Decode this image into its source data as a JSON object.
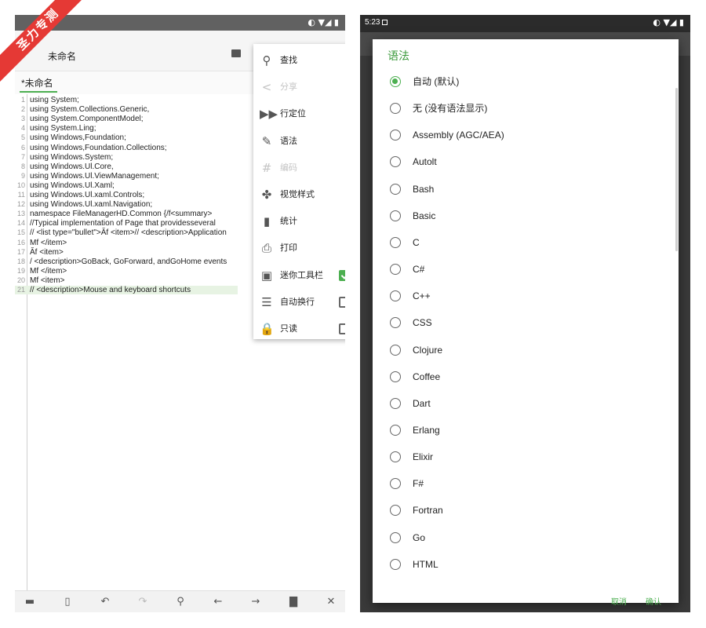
{
  "watermark": "圣力专测",
  "left": {
    "status_icons": "◐ ▼◢ ▮",
    "app_title": "未命名",
    "tab_label": "*未命名",
    "code_lines": [
      {
        "n": "1",
        "t": "using System;"
      },
      {
        "n": "2",
        "t": "using System.Collections.Generic,"
      },
      {
        "n": "3",
        "t": "using System.ComponentModel;"
      },
      {
        "n": "4",
        "t": "using System.Ling;"
      },
      {
        "n": "5",
        "t": "using Windows,Foundation;"
      },
      {
        "n": "6",
        "t": "using Windows,Foundation.Collections;"
      },
      {
        "n": "7",
        "t": "using Windows.System;"
      },
      {
        "n": "8",
        "t": "using Windows.Ul.Core,"
      },
      {
        "n": "9",
        "t": "using Windows.Ul.ViewManagement;"
      },
      {
        "n": "10",
        "t": "using Windows.Ul.Xaml;"
      },
      {
        "n": "11",
        "t": "using Windows.Ul.xaml.Controls;"
      },
      {
        "n": "12",
        "t": "using Windows.Ul.xaml.Navigation;"
      },
      {
        "n": "13",
        "t": "namespace FileManagerHD.Common {/f<summary>"
      },
      {
        "n": "14",
        "t": "//Typical implementation of Page that providesseveral"
      },
      {
        "n": "15",
        "t": "// <list type=\"bullet\">Ăf <item>// <description>Application"
      },
      {
        "n": "16",
        "t": "Mf </item>"
      },
      {
        "n": "17",
        "t": "Ăf <item>"
      },
      {
        "n": "18",
        "t": "/ <description>GoBack, GoForward, andGoHome events"
      },
      {
        "n": "19",
        "t": "Mf </item>"
      },
      {
        "n": "20",
        "t": "Mf <item>"
      },
      {
        "n": "21",
        "t": "// <description>Mouse and keyboard shortcuts"
      }
    ],
    "menu": [
      {
        "icon": "search-icon",
        "glyph": "⚲",
        "label": "查找",
        "disabled": false
      },
      {
        "icon": "share-icon",
        "glyph": "<",
        "label": "分享",
        "disabled": true
      },
      {
        "icon": "goto-line-icon",
        "glyph": "▶▶",
        "label": "行定位",
        "disabled": false
      },
      {
        "icon": "syntax-icon",
        "glyph": "✎",
        "label": "语法",
        "disabled": false
      },
      {
        "icon": "encoding-icon",
        "glyph": "#",
        "label": "编码",
        "disabled": true
      },
      {
        "icon": "visual-style-icon",
        "glyph": "✤",
        "label": "视觉样式",
        "disabled": false
      },
      {
        "icon": "statistics-icon",
        "glyph": "▮",
        "label": "统计",
        "disabled": false
      },
      {
        "icon": "print-icon",
        "glyph": "⎙",
        "label": "打印",
        "disabled": false
      },
      {
        "icon": "mini-toolbar-icon",
        "glyph": "▣",
        "label": "迷你工具栏",
        "disabled": false,
        "checked": true
      },
      {
        "icon": "word-wrap-icon",
        "glyph": "☰",
        "label": "自动换行",
        "disabled": false,
        "checked": false
      },
      {
        "icon": "lock-icon",
        "glyph": "🔒",
        "label": "只读",
        "disabled": false,
        "checked": false
      }
    ],
    "bottom_bar": [
      {
        "name": "open-folder-icon",
        "glyph": "▬",
        "dim": false
      },
      {
        "name": "new-file-icon",
        "glyph": "▯",
        "dim": false
      },
      {
        "name": "undo-icon",
        "glyph": "↶",
        "dim": false
      },
      {
        "name": "redo-icon",
        "glyph": "↷",
        "dim": true
      },
      {
        "name": "search-icon",
        "glyph": "⚲",
        "dim": false
      },
      {
        "name": "arrow-left-icon",
        "glyph": "←",
        "dim": false
      },
      {
        "name": "arrow-right-icon",
        "glyph": "→",
        "dim": false
      },
      {
        "name": "save-icon",
        "glyph": "▇",
        "dim": false
      },
      {
        "name": "close-icon",
        "glyph": "✕",
        "dim": false
      }
    ]
  },
  "right": {
    "status_time": "5:23",
    "status_icons": "◐ ▼◢ ▮",
    "dialog_title": "语法",
    "options": [
      {
        "label": "自动 (默认)",
        "selected": true
      },
      {
        "label": "无 (没有语法显示)",
        "selected": false
      },
      {
        "label": "Assembly (AGC/AEA)",
        "selected": false
      },
      {
        "label": "Autolt",
        "selected": false
      },
      {
        "label": "Bash",
        "selected": false
      },
      {
        "label": "Basic",
        "selected": false
      },
      {
        "label": "C",
        "selected": false
      },
      {
        "label": "C#",
        "selected": false
      },
      {
        "label": "C++",
        "selected": false
      },
      {
        "label": "CSS",
        "selected": false
      },
      {
        "label": "Clojure",
        "selected": false
      },
      {
        "label": "Coffee",
        "selected": false
      },
      {
        "label": "Dart",
        "selected": false
      },
      {
        "label": "Erlang",
        "selected": false
      },
      {
        "label": "Elixir",
        "selected": false
      },
      {
        "label": "F#",
        "selected": false
      },
      {
        "label": "Fortran",
        "selected": false
      },
      {
        "label": "Go",
        "selected": false
      },
      {
        "label": "HTML",
        "selected": false
      }
    ],
    "cancel_label": "取消",
    "ok_label": "确认"
  },
  "colors": {
    "accent": "#4caf50",
    "title_green": "#3c9a3c",
    "watermark_red": "#e53935"
  }
}
